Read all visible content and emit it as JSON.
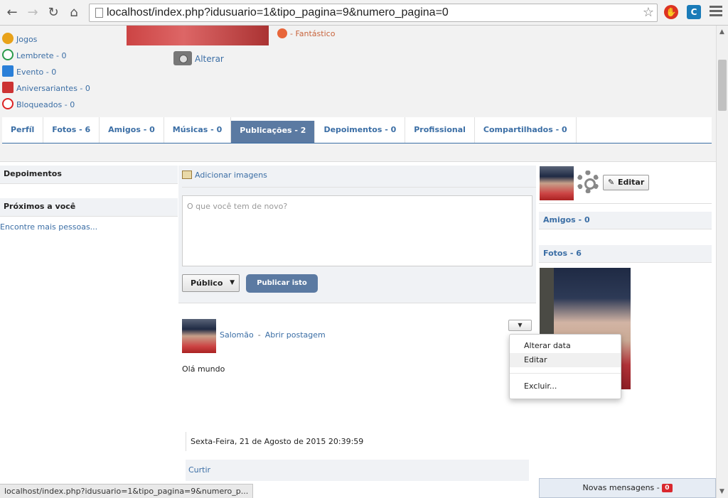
{
  "browser": {
    "url": "localhost/index.php?idusuario=1&tipo_pagina=9&numero_pagina=0",
    "status_url": "localhost/index.php?idusuario=1&tipo_pagina=9&numero_p..."
  },
  "profile": {
    "mood_text": "- Fantástico",
    "change_photo_label": "Alterar"
  },
  "left_menu": {
    "items": [
      {
        "label": "Jogos",
        "icon": "games-icon"
      },
      {
        "label": "Lembrete - 0",
        "icon": "clock-icon"
      },
      {
        "label": "Evento - 0",
        "icon": "calendar-icon"
      },
      {
        "label": "Aniversariantes - 0",
        "icon": "gift-icon"
      },
      {
        "label": "Bloqueados - 0",
        "icon": "block-icon"
      }
    ]
  },
  "tabs": [
    {
      "label": "Perfíl"
    },
    {
      "label": "Fotos - 6"
    },
    {
      "label": "Amigos - 0"
    },
    {
      "label": "Músicas - 0"
    },
    {
      "label": "Publicações - 2",
      "active": true
    },
    {
      "label": "Depoimentos - 0"
    },
    {
      "label": "Profissional"
    },
    {
      "label": "Compartilhados - 0"
    }
  ],
  "left_col": {
    "depoimentos_heading": "Depoimentos",
    "nearby_heading": "Próximos a você",
    "find_more_link": "Encontre mais pessoas..."
  },
  "composer": {
    "add_images_label": "Adicionar imagens",
    "placeholder": "O que você tem de novo?",
    "privacy_value": "Público",
    "publish_label": "Publicar isto"
  },
  "post": {
    "author": "Salomão",
    "separator": "-",
    "open_post_link": "Abrir postagem",
    "text": "Olá mundo",
    "date": "Sexta-Feira, 21 de Agosto de 2015 20:39:59",
    "like_label": "Curtir"
  },
  "post_menu": {
    "items": [
      "Alterar data",
      "Editar",
      "Excluir..."
    ]
  },
  "right_col": {
    "edit_label": "Editar",
    "friends_heading": "Amigos - 0",
    "photos_heading": "Fotos - 6"
  },
  "chat": {
    "new_messages_label": "Novas mensagens -",
    "new_messages_count": "0"
  },
  "colors": {
    "accent": "#5b7aa2",
    "link": "#3b6ea5",
    "badge": "#d9282e"
  }
}
